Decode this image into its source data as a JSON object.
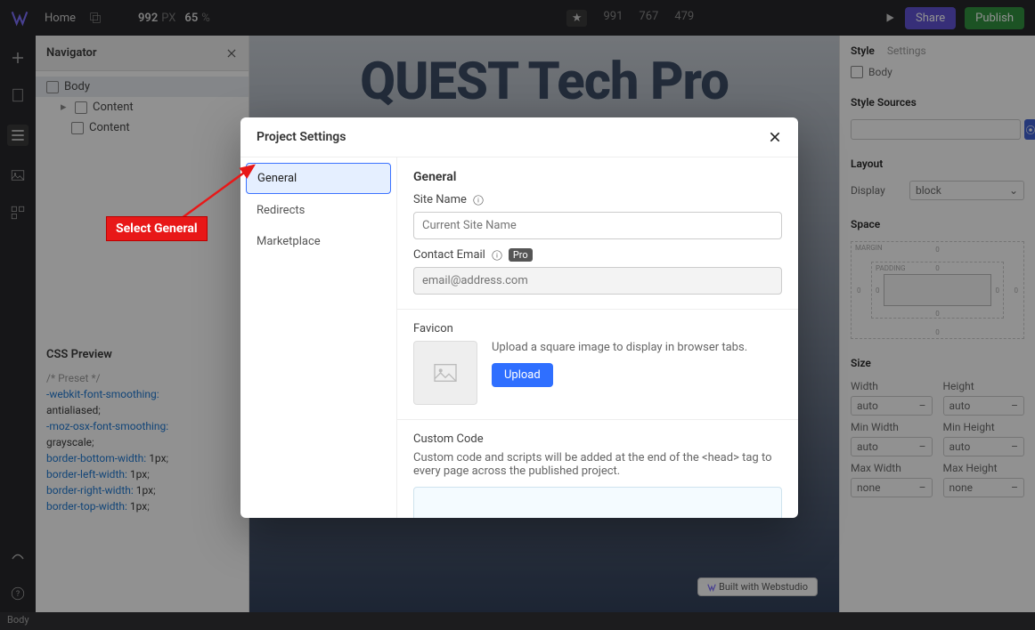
{
  "topbar": {
    "home": "Home",
    "width": "992",
    "px": "PX",
    "zoom": "65",
    "pct": "%",
    "bp": [
      "991",
      "767",
      "479"
    ],
    "share": "Share",
    "publish": "Publish"
  },
  "navigator": {
    "title": "Navigator",
    "nodes": {
      "body": "Body",
      "content1": "Content",
      "content2": "Content"
    }
  },
  "cssPreview": {
    "title": "CSS Preview",
    "comment": "/* Preset */",
    "p1": "-webkit-font-smoothing:",
    "v1": "antialiased",
    "p2": "-moz-osx-font-smoothing:",
    "v2": "grayscale",
    "p3": "border-bottom-width:",
    "p4": "border-left-width:",
    "p5": "border-right-width:",
    "p6": "border-top-width:",
    "px": "1px",
    "semi": ";"
  },
  "canvas": {
    "title": "QUEST Tech Pro",
    "built": "Built with Webstudio"
  },
  "rightPanel": {
    "tabs": {
      "style": "Style",
      "settings": "Settings"
    },
    "body": "Body",
    "styleSources": "Style Sources",
    "layout": "Layout",
    "display": "Display",
    "displayVal": "block",
    "space": "Space",
    "margin": "MARGIN",
    "padding": "PADDING",
    "zero": "0",
    "size": "Size",
    "width": "Width",
    "height": "Height",
    "minWidth": "Min Width",
    "minHeight": "Min Height",
    "maxWidth": "Max Width",
    "maxHeight": "Max Height",
    "auto": "auto",
    "none": "none"
  },
  "modal": {
    "title": "Project Settings",
    "tabs": {
      "general": "General",
      "redirects": "Redirects",
      "marketplace": "Marketplace"
    },
    "general": {
      "heading": "General",
      "siteName": "Site Name",
      "siteNamePh": "Current Site Name",
      "contactEmail": "Contact Email",
      "pro": "Pro",
      "emailPh": "email@address.com",
      "favicon": "Favicon",
      "faviconDesc": "Upload a square image to display in browser tabs.",
      "upload": "Upload",
      "customCode": "Custom Code",
      "customCodeDesc": "Custom code and scripts will be added at the end of the <head> tag to every page across the published project."
    }
  },
  "callout": "Select General",
  "status": "Body"
}
